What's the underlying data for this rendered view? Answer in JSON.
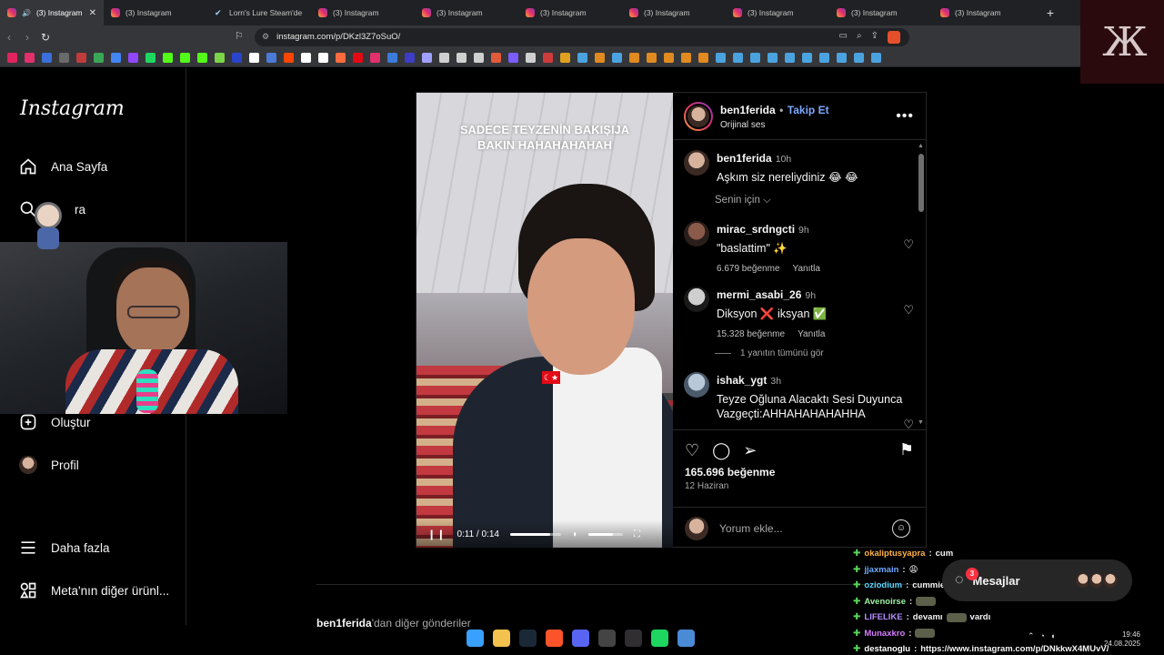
{
  "browser": {
    "tabs": [
      {
        "title": "(3) Instagram",
        "active": true,
        "icon": "instagram-icon"
      },
      {
        "title": "(3) Instagram",
        "icon": "instagram-icon"
      },
      {
        "title": "Lorn's Lure Steam'de",
        "icon": "steam-icon"
      },
      {
        "title": "(3) Instagram",
        "icon": "instagram-icon"
      },
      {
        "title": "(3) Instagram",
        "icon": "instagram-icon"
      },
      {
        "title": "(3) Instagram",
        "icon": "instagram-icon"
      },
      {
        "title": "(3) Instagram",
        "icon": "instagram-icon"
      },
      {
        "title": "(3) Instagram",
        "icon": "instagram-icon"
      },
      {
        "title": "(3) Instagram",
        "icon": "instagram-icon"
      },
      {
        "title": "(3) Instagram",
        "icon": "instagram-icon"
      }
    ],
    "url": "instagram.com/p/DKzl3Z7oSuO/",
    "new_tab": "+",
    "bookmark_colors": [
      "#e0245e",
      "#e1306c",
      "#3b6fd9",
      "#6a6a6a",
      "#c23b3b",
      "#3aa757",
      "#4285f4",
      "#9146ff",
      "#1ed760",
      "#53fc18",
      "#53fc18",
      "#53fc18",
      "#7bd548",
      "#2a45c9",
      "#ffffff",
      "#4a7bd9",
      "#ff4500",
      "#ffffff",
      "#ffffff",
      "#ff6b3d",
      "#e50914",
      "#e1306c",
      "#3b7bd9",
      "#3d3dc8",
      "#a0a0ff",
      "#cfcfcf",
      "#cfcfcf",
      "#cfcfcf",
      "#e25a3a",
      "#7a5cff",
      "#cfcfcf",
      "#cf3a3a",
      "#e0a020",
      "#4aa3df",
      "#e08a20",
      "#4aa3df",
      "#e08a20",
      "#e08a20",
      "#e08a20",
      "#e08a20",
      "#e08a20",
      "#4aa3df",
      "#4aa3df",
      "#4aa3df",
      "#4aa3df",
      "#4aa3df",
      "#4aa3df",
      "#4aa3df",
      "#4aa3df",
      "#4aa3df",
      "#4aa3df"
    ]
  },
  "sidebar": {
    "logo": "Instagram",
    "items": [
      {
        "label": "Ana Sayfa",
        "icon": "home-icon"
      },
      {
        "label": "Ara",
        "icon": "search-icon"
      },
      {
        "label": "Oluştur",
        "icon": "create-icon"
      },
      {
        "label": "Profil",
        "icon": "profile-avatar"
      },
      {
        "label": "Daha fazla",
        "icon": "menu-icon"
      },
      {
        "label": "Meta'nın diğer ürünl...",
        "icon": "meta-apps-icon"
      }
    ],
    "search_visible_fragment": "ra"
  },
  "post": {
    "video": {
      "caption_line1": "SADECE TEYZENİN BAKIŞIJA",
      "caption_line2": "BAKIN HAHAHAHAHAH",
      "time": "0:11 / 0:14",
      "progress": 0.79,
      "volume": 0.7,
      "flag": "☾★"
    },
    "author": "ben1ferida",
    "follow": "Takip Et",
    "dot": "•",
    "audio": "Orijinal ses",
    "caption": {
      "user": "ben1ferida",
      "time": "10h",
      "text": "Aşkım siz nereliydiniz 😂 😂"
    },
    "sort": "Senin için",
    "comments": [
      {
        "user": "mirac_srdngcti",
        "time": "9h",
        "text": "\"baslattim\" ✨",
        "likes": "6.679 beğenme",
        "reply": "Yanıtla"
      },
      {
        "user": "mermi_asabi_26",
        "time": "9h",
        "text": "Diksyon ❌ iksyan ✅",
        "likes": "15.328 beğenme",
        "reply": "Yanıtla"
      },
      {
        "user": "ishak_ygt",
        "time": "3h",
        "text": "Teyze Oğluna Alacaktı Sesi Duyunca Vazgeçti:AHHAHAHAHAHHA"
      }
    ],
    "view_replies": "1 yanıtın tümünü gör",
    "likes": "165.696 beğenme",
    "date": "12 Haziran",
    "comment_placeholder": "Yorum ekle..."
  },
  "more_from": {
    "user": "ben1ferida",
    "suffix": "'dan diğer gönderiler"
  },
  "chat": [
    {
      "user": "okaliptusyapra",
      "msg": "cum",
      "color": "#ffb347"
    },
    {
      "user": "jjaxmain",
      "msg": "😩",
      "color": "#6fa8ff"
    },
    {
      "user": "oziodium",
      "msg": "cummies",
      "color": "#5bd6ff"
    },
    {
      "user": "Avenoirse",
      "msg": "",
      "color": "#9bf0a0"
    },
    {
      "user": "LIFELIKE",
      "msg": "devamı",
      "msg2": "vardı",
      "color": "#b48bff"
    },
    {
      "user": "Munaxkro",
      "msg": "",
      "color": "#d77bff"
    },
    {
      "user": "destanoglu",
      "msg": "https://www.instagram.com/p/DNkkwX4MUvV/",
      "color": "#ffffff"
    }
  ],
  "messages": {
    "label": "Mesajlar",
    "badge": "3"
  },
  "taskbar": {
    "apps": [
      {
        "name": "windows-icon",
        "color": "#3aa0ff"
      },
      {
        "name": "file-explorer-icon",
        "color": "#f2c14e"
      },
      {
        "name": "steam-icon",
        "color": "#1b2838"
      },
      {
        "name": "brave-icon",
        "color": "#fb542b"
      },
      {
        "name": "discord-icon",
        "color": "#5865f2"
      },
      {
        "name": "app-icon",
        "color": "#444"
      },
      {
        "name": "obs-icon",
        "color": "#302e31"
      },
      {
        "name": "spotify-icon",
        "color": "#1ed760"
      },
      {
        "name": "app2-icon",
        "color": "#4a8bd6"
      }
    ],
    "time": "19:46",
    "date": "24.08.2025"
  }
}
